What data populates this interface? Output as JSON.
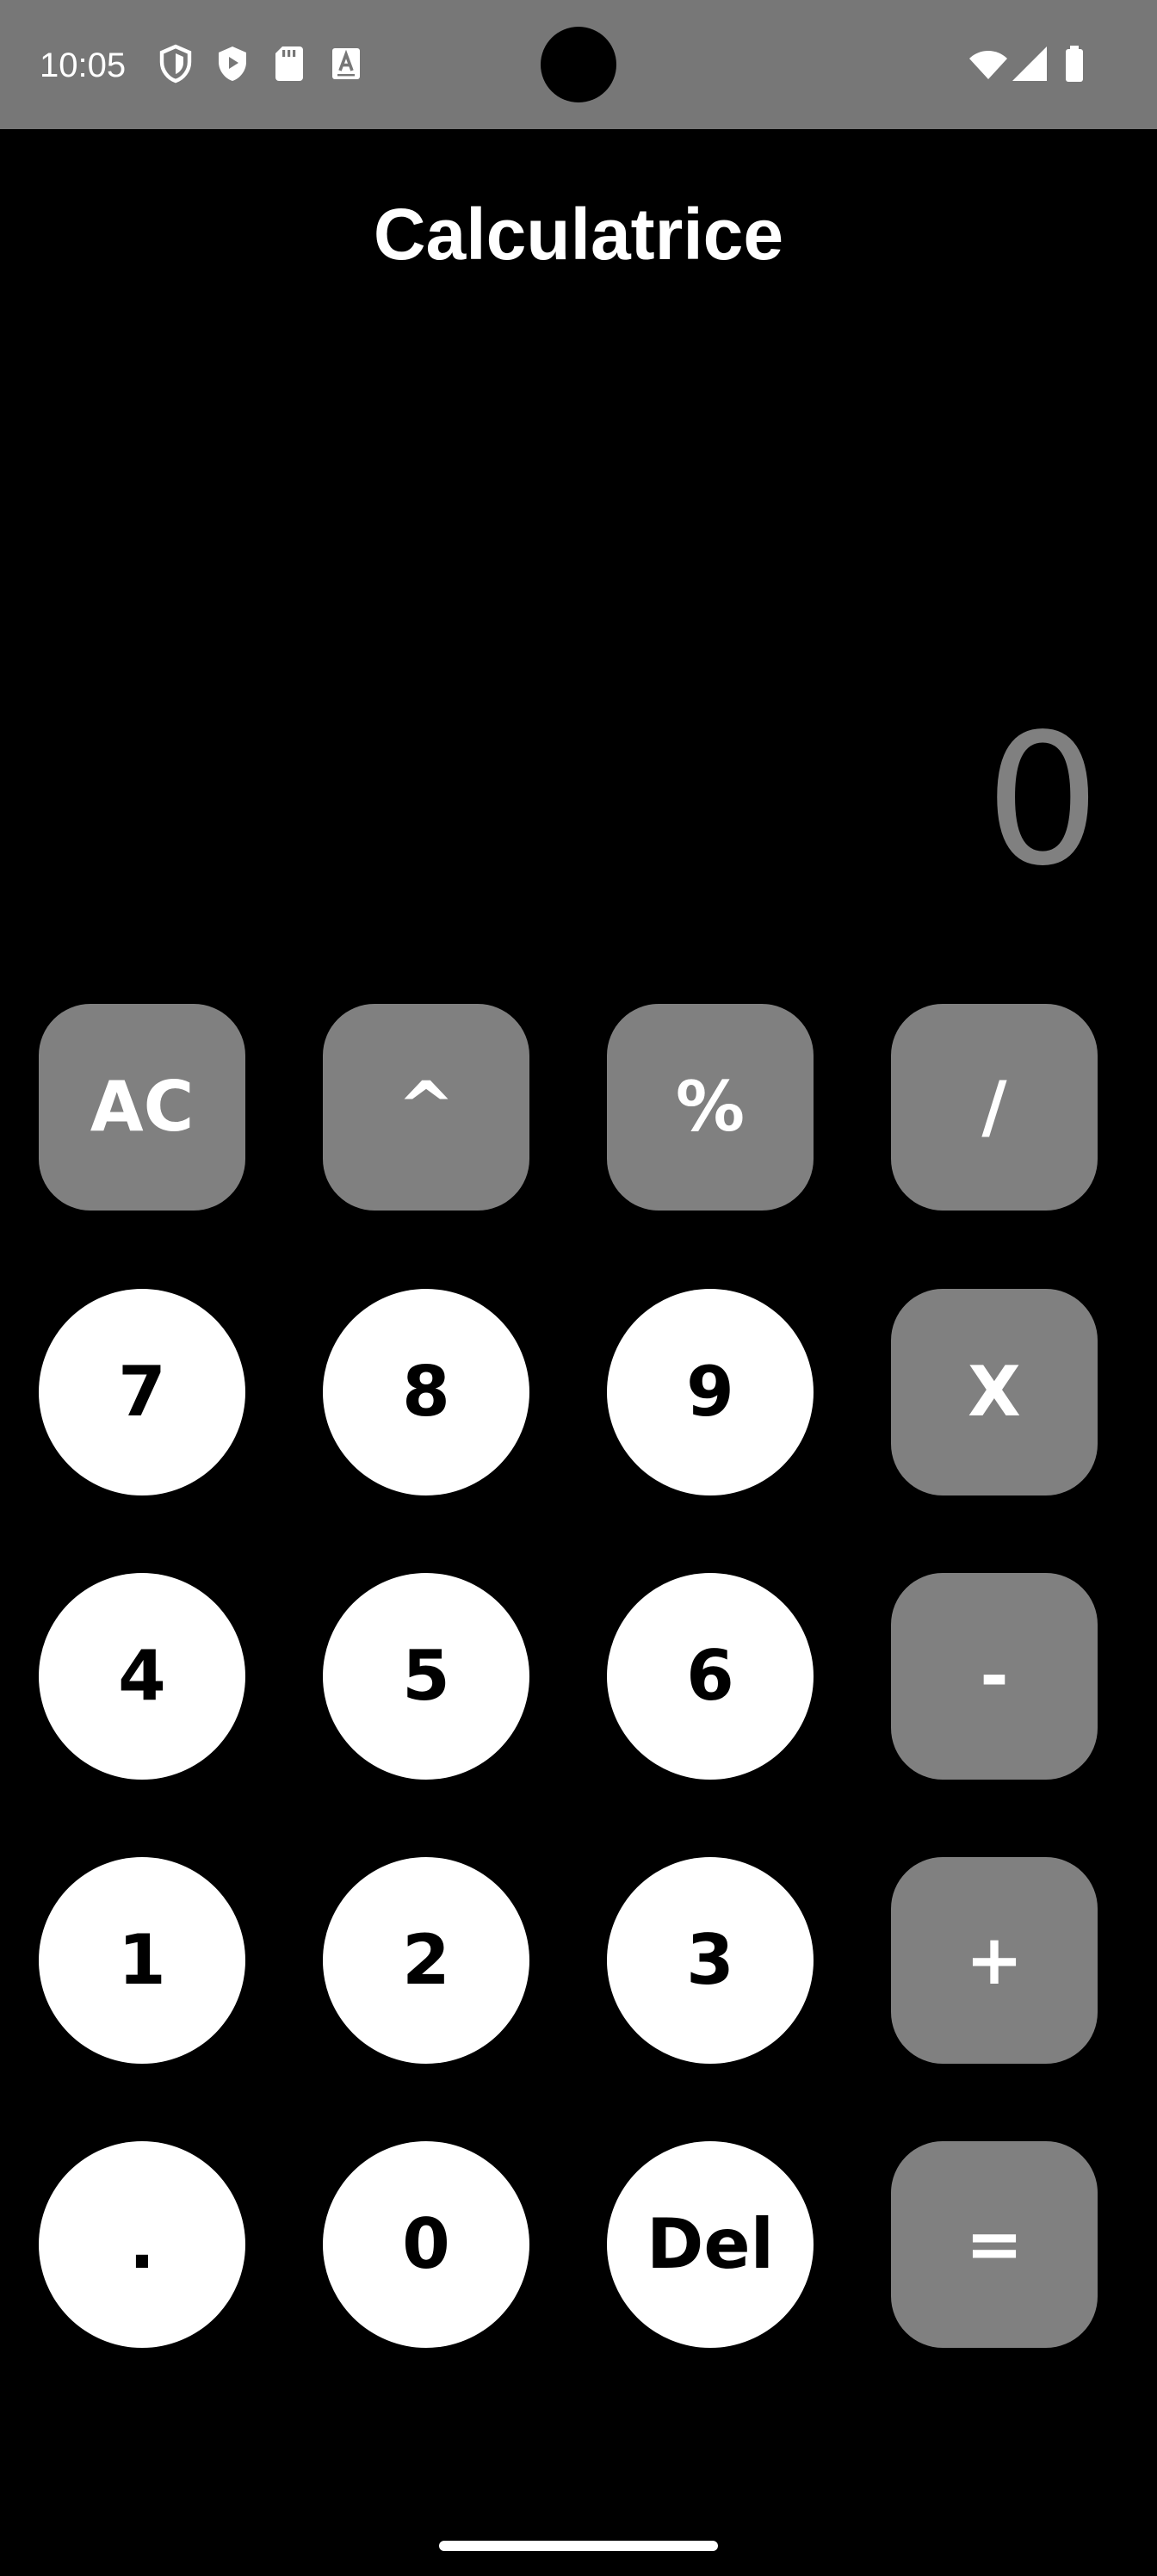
{
  "status_bar": {
    "time": "10:05",
    "left_icons": [
      "shield-outline-icon",
      "shield-play-icon",
      "sd-card-icon",
      "keyboard-a-icon"
    ],
    "right_icons": [
      "wifi-icon",
      "cellular-signal-icon",
      "battery-icon"
    ],
    "background": "#777777"
  },
  "app": {
    "title": "Calculatrice",
    "display_value": "0",
    "display_color": "#808080",
    "operator_key_color": "#808080",
    "number_key_color": "#ffffff"
  },
  "keypad": {
    "ac": "AC",
    "power": "^",
    "percent": "%",
    "divide": "/",
    "seven": "7",
    "eight": "8",
    "nine": "9",
    "multiply": "X",
    "four": "4",
    "five": "5",
    "six": "6",
    "minus": "-",
    "one": "1",
    "two": "2",
    "three": "3",
    "plus": "+",
    "dot": ".",
    "zero": "0",
    "delete": "Del",
    "equals": "="
  }
}
